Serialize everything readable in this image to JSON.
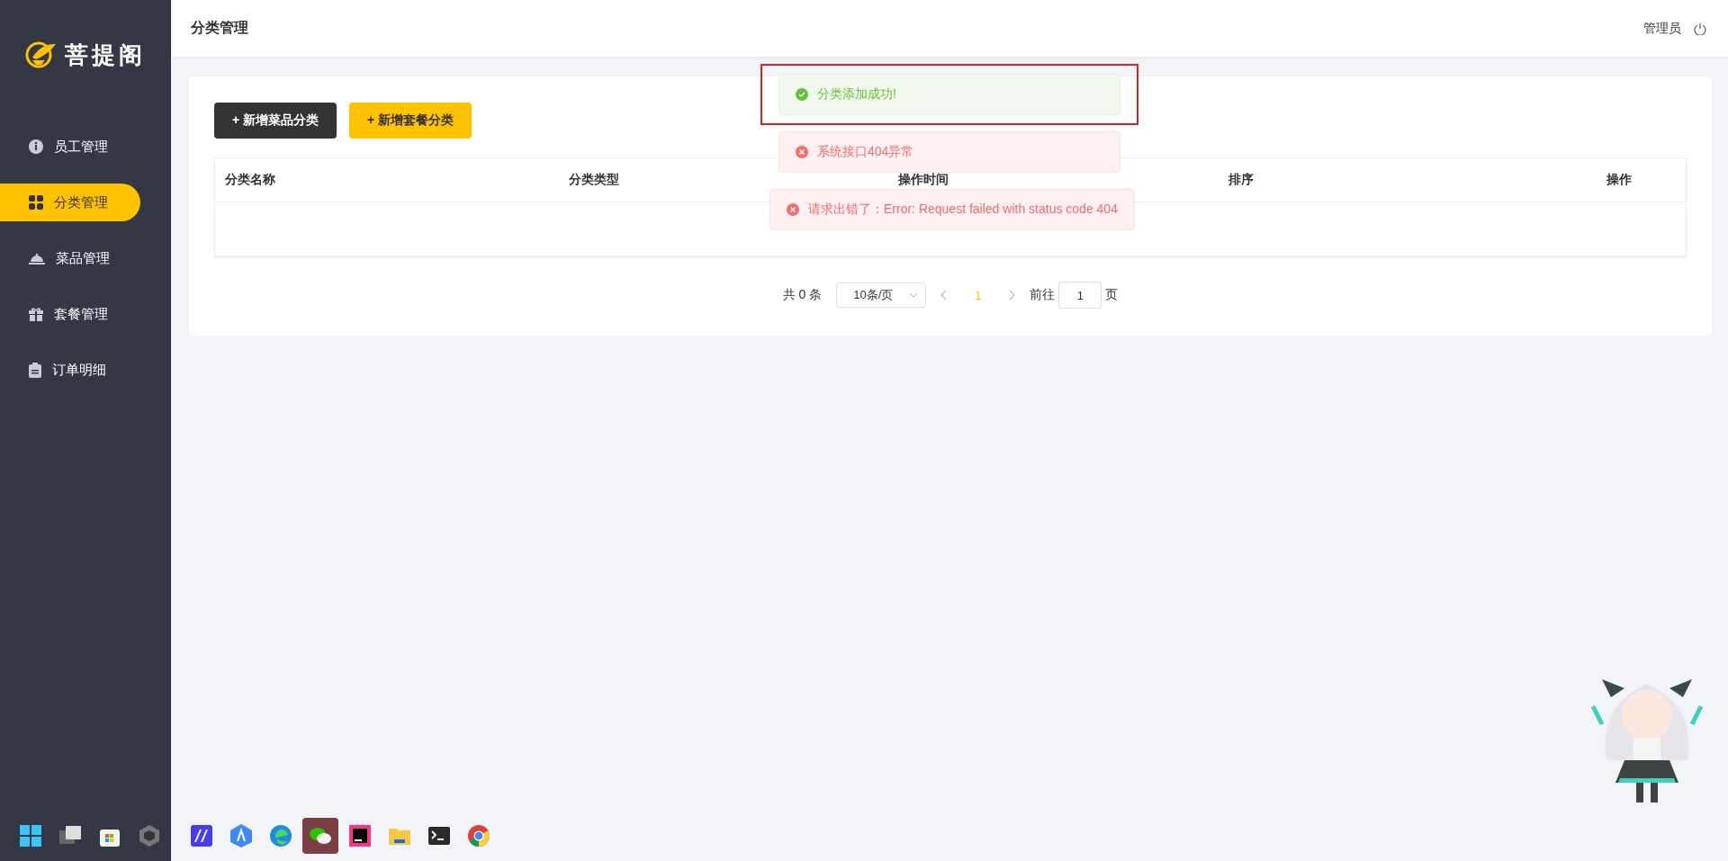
{
  "sidebar": {
    "logo_text": "菩提阁",
    "items": [
      {
        "label": "员工管理",
        "selected": false
      },
      {
        "label": "分类管理",
        "selected": true
      },
      {
        "label": "菜品管理",
        "selected": false
      },
      {
        "label": "套餐管理",
        "selected": false
      },
      {
        "label": "订单明细",
        "selected": false
      }
    ]
  },
  "header": {
    "title": "分类管理",
    "user": "管理员"
  },
  "buttons": [
    {
      "label": "+ 新增菜品分类",
      "kind": "dark"
    },
    {
      "label": "+ 新增套餐分类",
      "kind": "yellow"
    }
  ],
  "table": {
    "columns": [
      "分类名称",
      "分类类型",
      "操作时间",
      "排序",
      "操作"
    ]
  },
  "pagination": {
    "total": "共 0 条",
    "page_size": "10条/页",
    "current_page": "1",
    "goto_label": "前往",
    "goto_value": "1",
    "page_unit": "页"
  },
  "toasts": [
    {
      "kind": "success",
      "text": "分类添加成功!",
      "highlighted": true
    },
    {
      "kind": "error",
      "text": "系统接口404异常",
      "highlighted": false
    },
    {
      "kind": "error",
      "text": "请求出错了：Error: Request failed with status code 404",
      "highlighted": false
    }
  ],
  "taskbar": {
    "apps": [
      {
        "active": false
      },
      {
        "active": false
      },
      {
        "active": false
      },
      {
        "active": false
      },
      {
        "active": false
      },
      {
        "active": false
      },
      {
        "active": false
      },
      {
        "active": true
      },
      {
        "active": false
      },
      {
        "active": false
      },
      {
        "active": false
      },
      {
        "active": false
      }
    ]
  }
}
